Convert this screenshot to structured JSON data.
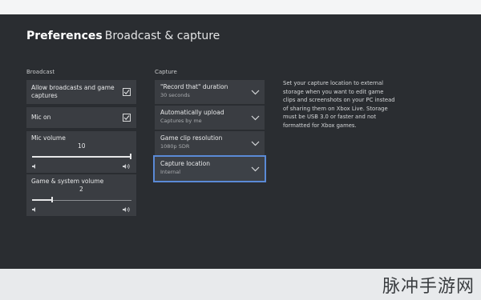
{
  "header": {
    "title_strong": "Preferences",
    "title_light": "Broadcast & capture"
  },
  "broadcast": {
    "label": "Broadcast",
    "allow": {
      "label_line1": "Allow broadcasts and game",
      "label_line2": "captures",
      "checked": true
    },
    "mic_on": {
      "label": "Mic on",
      "checked": true
    },
    "mic_volume": {
      "label": "Mic volume",
      "value": "10",
      "level": 1.0
    },
    "game_volume": {
      "label": "Game & system volume",
      "value": "2",
      "level": 0.2
    }
  },
  "capture": {
    "label": "Capture",
    "items": [
      {
        "title": "\"Record that\" duration",
        "value": "30 seconds"
      },
      {
        "title": "Automatically upload",
        "value": "Captures by me"
      },
      {
        "title": "Game clip resolution",
        "value": "1080p SDR"
      },
      {
        "title": "Capture location",
        "value": "Internal"
      }
    ]
  },
  "info": {
    "text": "Set your capture location to external storage when you want to edit game clips and screenshots on your PC instead of sharing them on Xbox Live. Storage must be USB 3.0 or faster and not formatted for Xbox games."
  },
  "watermark": {
    "text": "脉冲手游网"
  },
  "colors": {
    "background": "#2a2d31",
    "tile": "#3a3d42",
    "focus_outline": "#5a8ad6",
    "text": "#e6e7e8"
  },
  "icons": {
    "checkbox": "checkmark-icon",
    "chevron": "chevron-down-icon",
    "volume_low": "speaker-low-icon",
    "volume_high": "speaker-high-icon"
  }
}
